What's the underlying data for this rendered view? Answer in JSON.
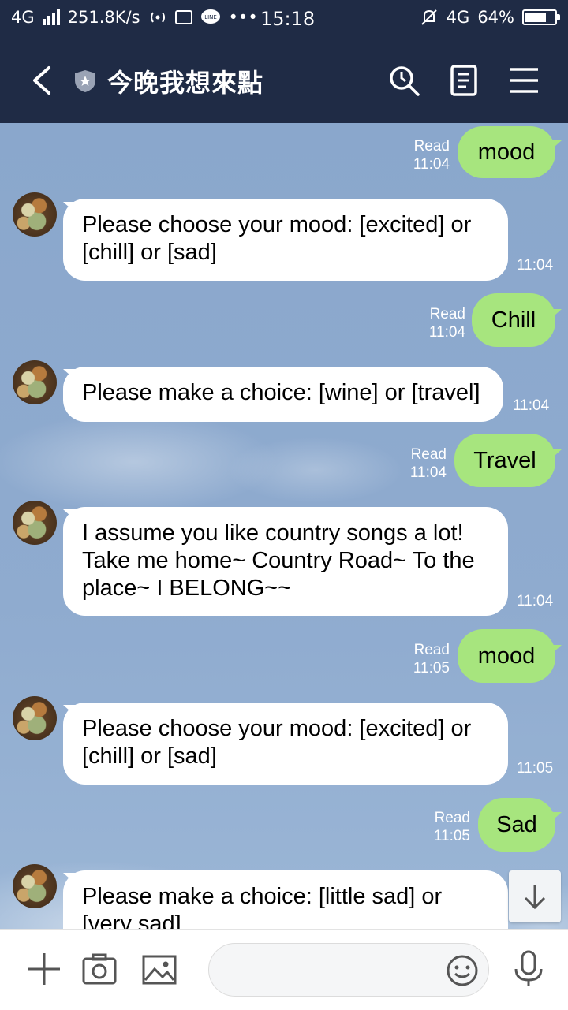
{
  "status_bar": {
    "network": "4G",
    "speed": "251.8K/s",
    "time": "15:18",
    "network_right": "4G",
    "battery": "64%"
  },
  "header": {
    "title": "今晚我想來點"
  },
  "messages": [
    {
      "side": "out",
      "text": "mood",
      "read": "Read",
      "time": "11:04"
    },
    {
      "side": "in",
      "lines": [
        "Please choose your mood: [excited] or",
        "[chill] or [sad]"
      ],
      "time": "11:04"
    },
    {
      "side": "out",
      "text": "Chill",
      "read": "Read",
      "time": "11:04"
    },
    {
      "side": "in",
      "lines": [
        "Please make a choice: [wine] or [travel]"
      ],
      "time": "11:04"
    },
    {
      "side": "out",
      "text": "Travel",
      "read": "Read",
      "time": "11:04"
    },
    {
      "side": "in",
      "lines": [
        "I assume you like country songs a lot!",
        "Take me home~ Country Road~ To the",
        "place~ I BELONG~~"
      ],
      "time": "11:04"
    },
    {
      "side": "out",
      "text": "mood",
      "read": "Read",
      "time": "11:05"
    },
    {
      "side": "in",
      "lines": [
        "Please choose your mood: [excited] or",
        "[chill] or [sad]"
      ],
      "time": "11:05"
    },
    {
      "side": "out",
      "text": "Sad",
      "read": "Read",
      "time": "11:05"
    },
    {
      "side": "in",
      "lines": [
        "Please make a choice: [little sad] or",
        "[very sad]"
      ],
      "time": ""
    }
  ],
  "input": {
    "placeholder": ""
  },
  "colors": {
    "header_bg": "#1f2b45",
    "outgoing_bubble": "#a7e57e",
    "incoming_bubble": "#ffffff"
  },
  "icons": {
    "back": "chevron-left-icon",
    "shield": "shield-star-icon",
    "search": "search-icon",
    "notes": "notes-icon",
    "menu": "menu-icon",
    "plus": "plus-icon",
    "camera": "camera-icon",
    "image": "image-icon",
    "emoji": "emoji-icon",
    "mic": "microphone-icon",
    "scroll_down": "arrow-down-icon"
  }
}
